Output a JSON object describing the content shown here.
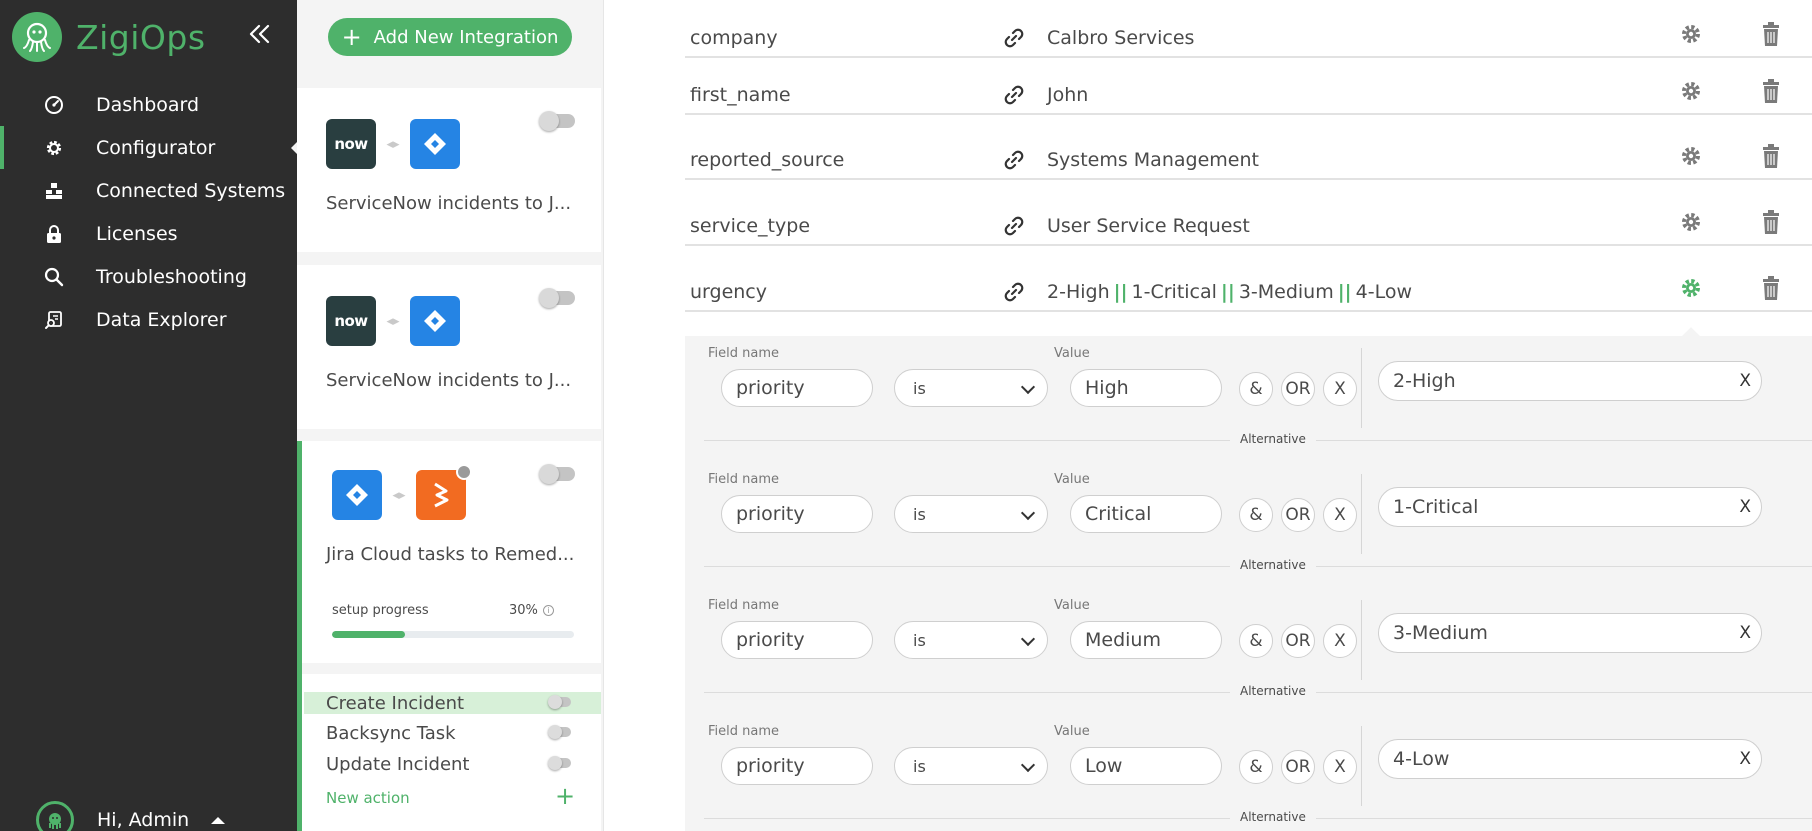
{
  "app": {
    "name": "ZigiOps",
    "brand_color": "#4fb26a",
    "collapse_icon": "double-chevron-left-icon"
  },
  "sidebar": {
    "items": [
      {
        "label": "Dashboard",
        "icon": "gauge-icon"
      },
      {
        "label": "Configurator",
        "icon": "gear-icon",
        "active": true
      },
      {
        "label": "Connected Systems",
        "icon": "systems-icon"
      },
      {
        "label": "Licenses",
        "icon": "lock-icon"
      },
      {
        "label": "Troubleshooting",
        "icon": "search-icon"
      },
      {
        "label": "Data Explorer",
        "icon": "data-explorer-icon"
      }
    ],
    "user": {
      "greeting": "Hi, Admin",
      "avatar_icon": "octopus-avatar-icon"
    }
  },
  "integrations": {
    "add_button": "Add New Integration",
    "cards": [
      {
        "title": "ServiceNow incidents to J...",
        "source": "ServiceNow",
        "source_mark": "now",
        "target": "Jira Cloud",
        "enabled": false
      },
      {
        "title": "ServiceNow incidents to J...",
        "source": "ServiceNow",
        "source_mark": "now",
        "target": "Jira Cloud",
        "enabled": false
      },
      {
        "title": "Jira Cloud tasks to Remed...",
        "source": "Jira Cloud",
        "target": "BMC Remedy",
        "enabled": false,
        "setup_progress_label": "setup progress",
        "setup_progress_text": "30%",
        "setup_progress": 0.3
      }
    ],
    "actions": [
      {
        "label": "Create Incident",
        "active": true
      },
      {
        "label": "Backsync Task"
      },
      {
        "label": "Update Incident"
      }
    ],
    "new_action": "New action"
  },
  "fields": [
    {
      "name": "company",
      "value": "Calbro Services"
    },
    {
      "name": "first_name",
      "value": "John"
    },
    {
      "name": "reported_source",
      "value": "Systems Management"
    },
    {
      "name": "service_type",
      "value": "User Service Request"
    },
    {
      "name": "urgency",
      "values": [
        "2-High",
        "1-Critical",
        "3-Medium",
        "4-Low"
      ],
      "separator": "||",
      "expanded": true
    }
  ],
  "conditions": {
    "field_name_label": "Field name",
    "value_label": "Value",
    "alternative_label": "Alternative",
    "op_and": "&",
    "op_or": "OR",
    "op_remove": "X",
    "rows": [
      {
        "field": "priority",
        "operator": "is",
        "value": "High",
        "result": "2-High"
      },
      {
        "field": "priority",
        "operator": "is",
        "value": "Critical",
        "result": "1-Critical"
      },
      {
        "field": "priority",
        "operator": "is",
        "value": "Medium",
        "result": "3-Medium"
      },
      {
        "field": "priority",
        "operator": "is",
        "value": "Low",
        "result": "4-Low"
      }
    ],
    "clear_label": "X"
  }
}
